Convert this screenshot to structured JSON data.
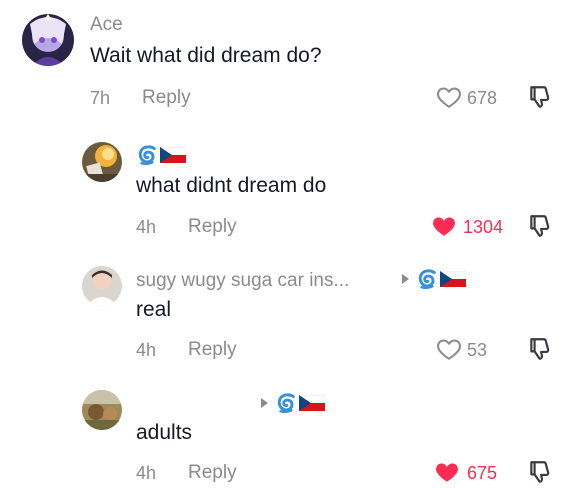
{
  "comments": [
    {
      "username": "Ace",
      "text": "Wait what did dream do?",
      "time": "7h",
      "reply_label": "Reply",
      "likes": "678",
      "liked": false
    },
    {
      "username": "",
      "text": "what didnt dream do",
      "time": "4h",
      "reply_label": "Reply",
      "likes": "1304",
      "liked": true
    },
    {
      "username": "sugy wugy suga car ins...",
      "text": "real",
      "time": "4h",
      "reply_label": "Reply",
      "likes": "53",
      "liked": false
    },
    {
      "username": "",
      "text": "adults",
      "time": "4h",
      "reply_label": "Reply",
      "likes": "675",
      "liked": true
    }
  ],
  "colors": {
    "like_red": "#fe2c55",
    "muted_gray": "#8a8b91",
    "text": "#161823",
    "emoji_blue": "#3b8fd9"
  },
  "icons": [
    "heart-outline-icon",
    "heart-filled-icon",
    "dislike-icon",
    "cyclone-emoji-icon",
    "czech-flag-icon",
    "reply-arrow-icon"
  ]
}
